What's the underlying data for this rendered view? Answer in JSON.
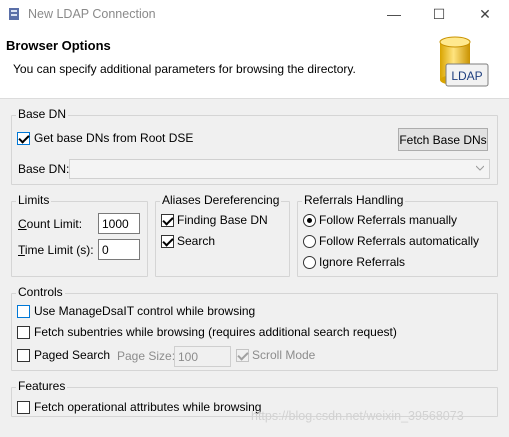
{
  "window": {
    "title": "New LDAP Connection",
    "controls": {
      "minimize": "—",
      "maximize": "☐",
      "close": "✕"
    }
  },
  "header": {
    "title": "Browser Options",
    "description": "You can specify additional parameters for browsing the directory.",
    "logo_text": "LDAP"
  },
  "base_dn": {
    "group_label": "Base DN",
    "get_from_root_dse": {
      "label": "Get base DNs from Root DSE",
      "checked": true
    },
    "fetch_button": "Fetch Base DNs",
    "base_dn_label": "Base DN:",
    "base_dn_value": ""
  },
  "limits": {
    "group_label": "Limits",
    "count_limit_label_ul": "C",
    "count_limit_label_rest": "ount Limit:",
    "count_limit_value": "1000",
    "time_limit_label_ul": "T",
    "time_limit_label_rest": "ime Limit (s):",
    "time_limit_value": "0"
  },
  "aliases": {
    "group_label": "Aliases Dereferencing",
    "finding_base_dn": {
      "label": "Finding Base DN",
      "checked": true
    },
    "search": {
      "label": "Search",
      "checked": true
    }
  },
  "referrals": {
    "group_label": "Referrals Handling",
    "options": [
      {
        "label": "Follow Referrals manually",
        "selected": true
      },
      {
        "label": "Follow Referrals automatically",
        "selected": false
      },
      {
        "label": "Ignore Referrals",
        "selected": false
      }
    ]
  },
  "controls": {
    "group_label": "Controls",
    "manage_dsait": {
      "label": "Use ManageDsaIT control while browsing",
      "checked": false
    },
    "fetch_subentries": {
      "label": "Fetch subentries while browsing (requires additional search request)",
      "checked": false
    },
    "paged_search": {
      "label": "Paged Search",
      "checked": false
    },
    "page_size_label": "Page Size:",
    "page_size_value": "100",
    "scroll_mode": {
      "label": "Scroll Mode",
      "checked": true
    }
  },
  "features": {
    "group_label": "Features",
    "fetch_operational": {
      "label": "Fetch operational attributes while browsing",
      "checked": false
    }
  },
  "watermark": "https://blog.csdn.net/weixin_39568073",
  "colors": {
    "accent": "#0078d7",
    "header_bg": "#ffffff",
    "dialog_bg": "#f0f0f0"
  }
}
